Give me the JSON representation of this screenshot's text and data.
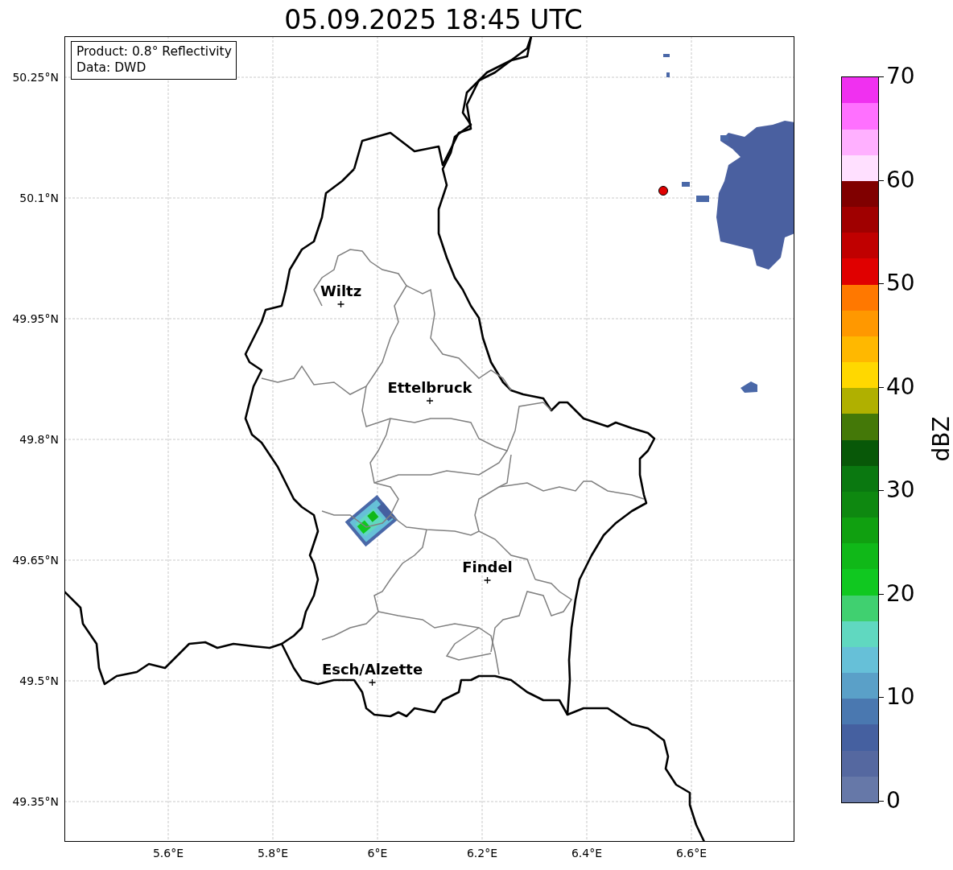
{
  "title": "05.09.2025 18:45 UTC",
  "map": {
    "legend_lines": [
      "Product: 0.8° Reflectivity",
      "Data: DWD"
    ],
    "yticks": [
      "50.25°N",
      "50.1°N",
      "49.95°N",
      "49.8°N",
      "49.65°N",
      "49.5°N",
      "49.35°N"
    ],
    "xticks": [
      "5.6°E",
      "5.8°E",
      "6°E",
      "6.2°E",
      "6.4°E",
      "6.6°E"
    ],
    "places": [
      {
        "name": "Wiltz"
      },
      {
        "name": "Ettelbruck"
      },
      {
        "name": "Findel"
      },
      {
        "name": "Esch/Alzette"
      }
    ]
  },
  "colorbar": {
    "label": "dBZ",
    "ticks": [
      "70",
      "60",
      "50",
      "40",
      "30",
      "20",
      "10",
      "0"
    ]
  }
}
